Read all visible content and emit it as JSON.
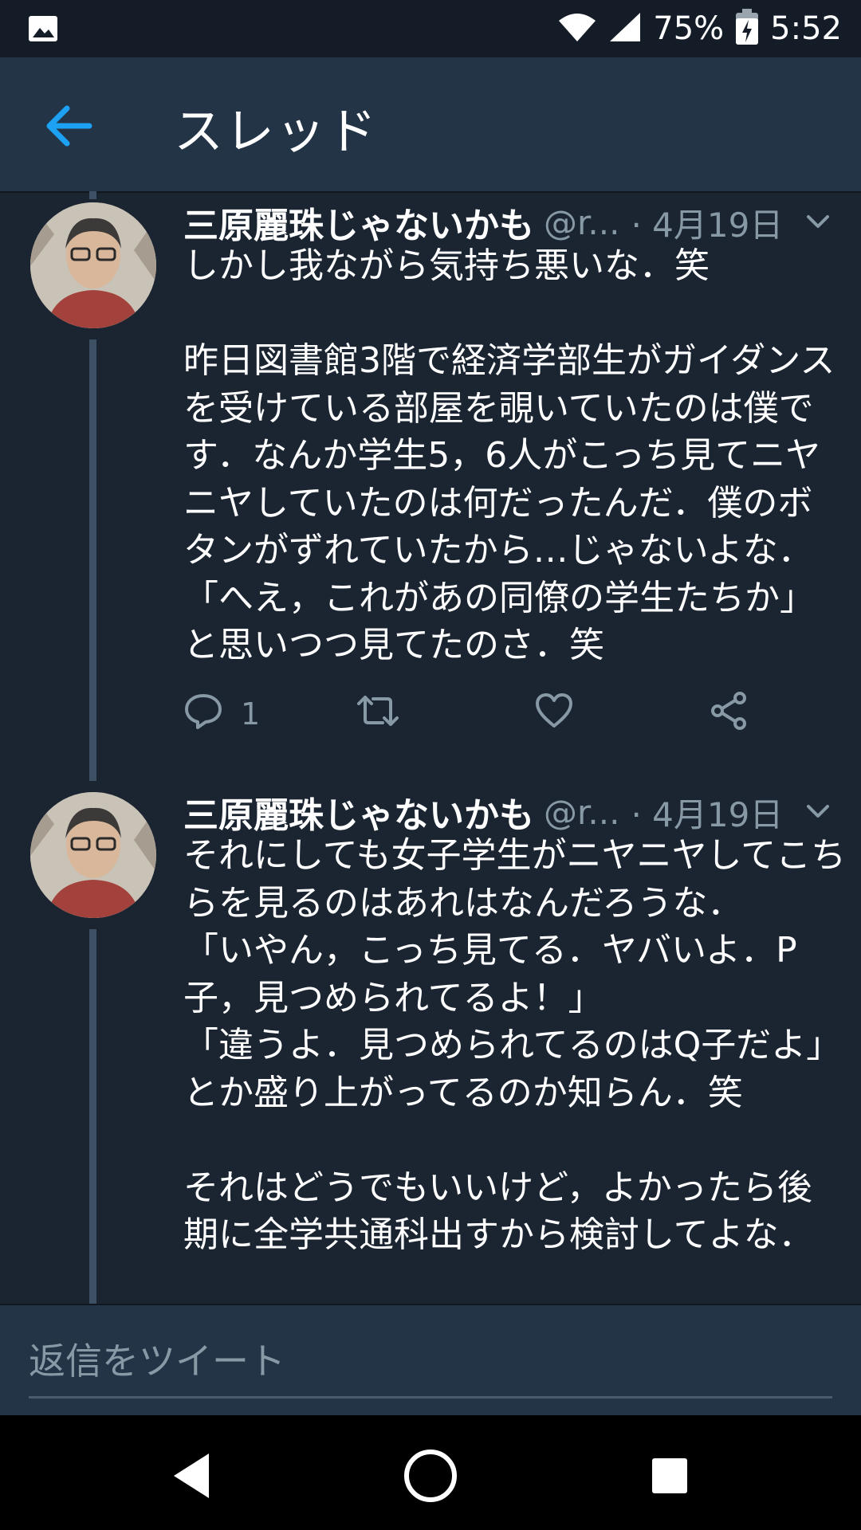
{
  "status_bar": {
    "battery": "75%",
    "time": "5:52",
    "icons": [
      "image-icon",
      "wifi-icon",
      "signal-icon",
      "battery-charging-icon"
    ]
  },
  "header": {
    "title": "スレッド",
    "back_icon": "back-arrow-icon"
  },
  "tweets": [
    {
      "name": "三原麗珠じゃないかも",
      "handle": "@r...",
      "date": "· 4月19日",
      "text": "しかし我ながら気持ち悪いな．笑\n\n昨日図書館3階で経済学部生がガイダンスを受けている部屋を覗いていたのは僕です．なんか学生5，6人がこっち見てニヤニヤしていたのは何だったんだ．僕のボタンがずれていたから…じゃないよな．「へえ，これがあの同僚の学生たちか」と思いつつ見てたのさ．笑",
      "reply_count": "1"
    },
    {
      "name": "三原麗珠じゃないかも",
      "handle": "@r...",
      "date": "· 4月19日",
      "text": "それにしても女子学生がニヤニヤしてこちらを見るのはあれはなんだろうな．\n「いやん，こっち見てる．ヤバいよ．P子，見つめられてるよ！」\n「違うよ．見つめられてるのはQ子だよ」\nとか盛り上がってるのか知らん．笑\n\nそれはどうでもいいけど，よかったら後期に全学共通科出すから検討してよな．"
    }
  ],
  "reply_bar": {
    "placeholder": "返信をツイート"
  },
  "nav_bar": {
    "icons": [
      "nav-back-icon",
      "nav-home-icon",
      "nav-recents-icon"
    ]
  },
  "colors": {
    "background": "#1b2532",
    "header": "#243447",
    "accent": "#1da1f2",
    "muted": "#8899a6"
  }
}
